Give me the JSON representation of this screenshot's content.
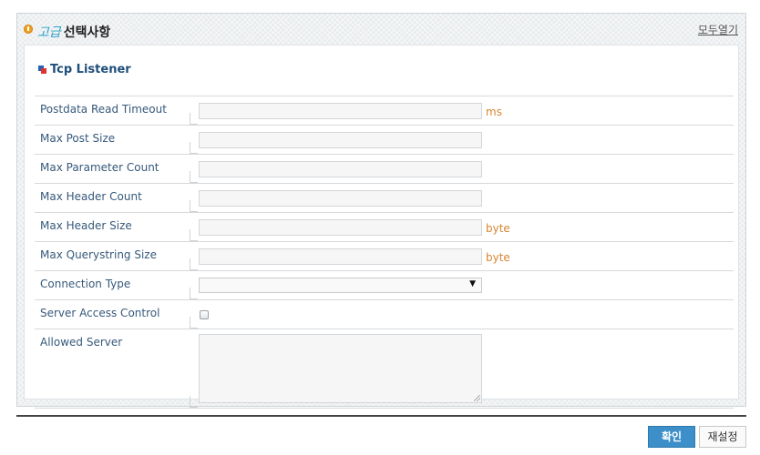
{
  "header": {
    "title_accent": "고급",
    "title_main": "선택사항",
    "expand_all_label": "모두열기"
  },
  "section": {
    "title": "Tcp Listener"
  },
  "fields": {
    "postdata_read_timeout": {
      "label": "Postdata Read Timeout",
      "value": "",
      "unit": "ms"
    },
    "max_post_size": {
      "label": "Max Post Size",
      "value": ""
    },
    "max_parameter_count": {
      "label": "Max Parameter Count",
      "value": ""
    },
    "max_header_count": {
      "label": "Max Header Count",
      "value": ""
    },
    "max_header_size": {
      "label": "Max Header Size",
      "value": "",
      "unit": "byte"
    },
    "max_querystring_size": {
      "label": "Max Querystring Size",
      "value": "",
      "unit": "byte"
    },
    "connection_type": {
      "label": "Connection Type",
      "selected": ""
    },
    "server_access_control": {
      "label": "Server Access Control",
      "checked": false
    },
    "allowed_server": {
      "label": "Allowed Server",
      "value": ""
    }
  },
  "buttons": {
    "confirm_label": "확인",
    "reset_label": "재설정"
  },
  "colors": {
    "label_text": "#36597a",
    "unit_text": "#d88630",
    "accent_title": "#2aa2c6",
    "section_title": "#1f4e7a",
    "confirm_button": "#3c8fc8"
  },
  "icons": {
    "header": "info-bulb-icon",
    "section": "section-square-icon",
    "select_arrow": "dropdown-arrow-icon"
  }
}
